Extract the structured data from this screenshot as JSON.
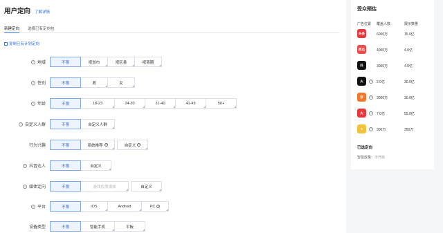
{
  "header": {
    "title": "用户定向",
    "help_link": "了解详情"
  },
  "tabs": [
    {
      "label": "新建定向",
      "active": true
    },
    {
      "label": "选择已有定向包",
      "active": false
    }
  ],
  "copy_link": "复制已有计划定向",
  "rows": [
    {
      "label": "地域",
      "help": true,
      "options": [
        {
          "text": "不限",
          "sel": true
        },
        {
          "text": "按省市"
        },
        {
          "text": "按区县"
        },
        {
          "text": "按商圈"
        }
      ]
    },
    {
      "label": "性别",
      "help": true,
      "options": [
        {
          "text": "不限",
          "sel": true
        },
        {
          "text": "男"
        },
        {
          "text": "女"
        }
      ]
    },
    {
      "label": "年龄",
      "help": true,
      "options": [
        {
          "text": "不限",
          "sel": true
        },
        {
          "text": "18-23"
        },
        {
          "text": "24-30"
        },
        {
          "text": "31-40"
        },
        {
          "text": "41-49"
        },
        {
          "text": "50+"
        }
      ]
    },
    {
      "label": "自定义人群",
      "help": true,
      "options": [
        {
          "text": "不限",
          "sel": true
        },
        {
          "text": "自定义人群"
        }
      ]
    },
    {
      "label": "行为兴趣",
      "help": false,
      "options": [
        {
          "text": "不限",
          "sel": true
        },
        {
          "text": "系统推荐",
          "q": true
        },
        {
          "text": "自定义",
          "q": true
        }
      ]
    },
    {
      "label": "抖音达人",
      "help": true,
      "options": [
        {
          "text": "不限",
          "sel": true
        },
        {
          "text": "自定义"
        }
      ]
    },
    {
      "label": "媒体定向",
      "help": true,
      "options": [
        {
          "text": "不限",
          "sel": true
        },
        {
          "text": "游戏优质媒体",
          "dis": true
        },
        {
          "text": "自定义"
        }
      ]
    },
    {
      "label": "平台",
      "help": true,
      "options": [
        {
          "text": "不限",
          "sel": true
        },
        {
          "text": "iOS"
        },
        {
          "text": "Android"
        },
        {
          "text": "PC",
          "q": true
        }
      ]
    },
    {
      "label": "设备类型",
      "help": false,
      "options": [
        {
          "text": "不限",
          "sel": true
        },
        {
          "text": "智能手机"
        },
        {
          "text": "平板"
        }
      ]
    }
  ],
  "audience": {
    "title": "受众预估",
    "col_headers": [
      "广告位置",
      "覆盖人数",
      "展示数量"
    ],
    "rows": [
      {
        "icon": "toutiao-icon",
        "icon_text": "头条",
        "icon_color": "#e8383d",
        "help": false,
        "users": "6000万",
        "shows": "15.0亿"
      },
      {
        "icon": "xigua-icon",
        "icon_text": "西瓜",
        "icon_color": "#f04a4a",
        "help": false,
        "users": "4000万",
        "shows": "4.0亿"
      },
      {
        "icon": "douyin-icon",
        "icon_text": "抖",
        "icon_color": "#111111",
        "help": false,
        "users": "3000万",
        "shows": "4.9亿"
      },
      {
        "icon": "douyin-volcano-icon",
        "icon_text": "火",
        "icon_color": "#111111",
        "help": true,
        "users": "2.0亿",
        "shows": "30.0亿"
      },
      {
        "icon": "pangle-icon",
        "icon_text": "穿",
        "icon_color": "#f0782a",
        "help": true,
        "users": "3000万",
        "shows": "30.0亿"
      },
      {
        "icon": "huoshan-icon",
        "icon_text": "火",
        "icon_color": "#e8383d",
        "help": true,
        "users": "7.0亿",
        "shows": "55.0亿"
      },
      {
        "icon": "coin-icon",
        "icon_text": "¥",
        "icon_color": "#f3c23c",
        "help": true,
        "users": "300万",
        "shows": "350万"
      }
    ],
    "selected_title": "已选定向",
    "selected_label": "智能放量：",
    "selected_value": "不开启"
  }
}
